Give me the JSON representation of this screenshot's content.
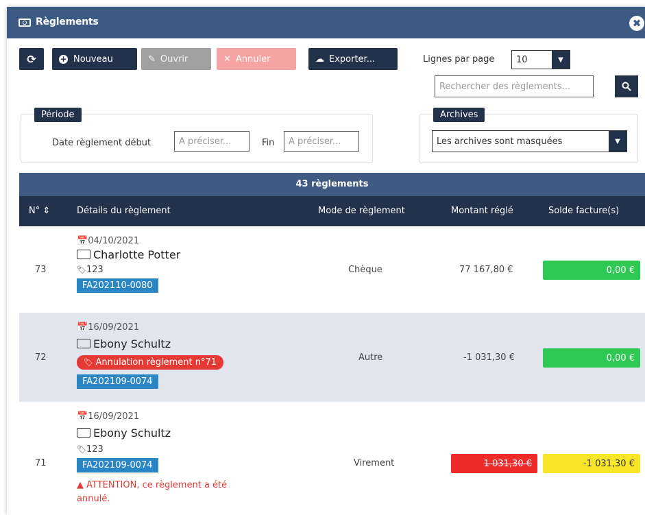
{
  "window": {
    "title": "Règlements",
    "close_glyph": "✖"
  },
  "toolbar": {
    "refresh_glyph": "⟳",
    "new_label": "Nouveau",
    "open_label": "Ouvrir",
    "cancel_label": "Annuler",
    "export_label": "Exporter...",
    "rows_per_page_label": "Lignes par page",
    "rows_per_page_value": "10"
  },
  "search": {
    "placeholder": "Rechercher des règlements..."
  },
  "period": {
    "legend": "Période",
    "start_label": "Date règlement début",
    "start_placeholder": "A préciser...",
    "end_label": "Fin",
    "end_placeholder": "A préciser..."
  },
  "archives": {
    "legend": "Archives",
    "value": "Les archives sont masquées"
  },
  "table": {
    "caption": "43 règlements",
    "headers": {
      "num": "N° ⇕",
      "details": "Détails du règlement",
      "mode": "Mode de règlement",
      "amount": "Montant réglé",
      "balance": "Solde facture(s)"
    },
    "rows": [
      {
        "num": "73",
        "date": "04/10/2021",
        "client": "Charlotte Potter",
        "ref": "123",
        "invoice": "FA202110-0080",
        "mode": "Chèque",
        "amount": "77 167,80 €",
        "balance": "0,00 €"
      },
      {
        "num": "72",
        "date": "16/09/2021",
        "client": "Ebony Schultz",
        "cancel_badge": "Annulation règlement n°71",
        "invoice": "FA202109-0074",
        "mode": "Autre",
        "amount": "-1 031,30 €",
        "balance": "0,00 €"
      },
      {
        "num": "71",
        "date": "16/09/2021",
        "client": "Ebony Schultz",
        "ref": "123",
        "invoice": "FA202109-0074",
        "warning": "ATTENTION, ce règlement a été annulé.",
        "mode": "Virement",
        "amount": "1 031,30 €",
        "balance": "-1 031,30 €"
      }
    ]
  },
  "colors": {
    "header_blue": "#3c5a82",
    "dark_navy": "#22324a",
    "invoice_blue": "#2b86c5",
    "green": "#2ec955",
    "yellow": "#f9e62a",
    "red": "#ee2b2b"
  }
}
